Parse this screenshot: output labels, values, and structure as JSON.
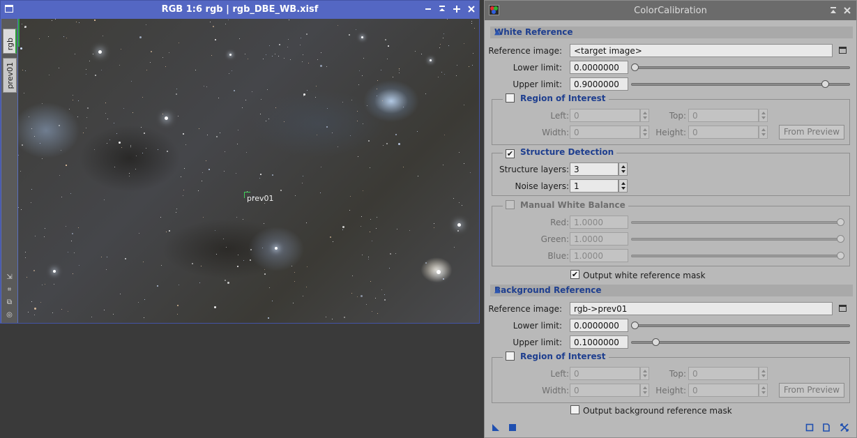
{
  "image_window": {
    "title": "RGB 1:6 rgb | rgb_DBE_WB.xisf",
    "tabs": [
      "rgb",
      "prev01"
    ],
    "preview_label": "prev01",
    "buttons": [
      "shade",
      "maximize",
      "close"
    ]
  },
  "panel": {
    "title": "ColorCalibration",
    "white_reference": {
      "header": "White Reference",
      "reference_image_label": "Reference image:",
      "reference_image_value": "<target image>",
      "lower_limit_label": "Lower limit:",
      "lower_limit_value": "0.0000000",
      "lower_limit_slider": 0.0,
      "upper_limit_label": "Upper limit:",
      "upper_limit_value": "0.9000000",
      "upper_limit_slider": 0.9,
      "roi": {
        "title": "Region of Interest",
        "checked": false,
        "left_label": "Left:",
        "left_value": "0",
        "top_label": "Top:",
        "top_value": "0",
        "width_label": "Width:",
        "width_value": "0",
        "height_label": "Height:",
        "height_value": "0",
        "from_preview": "From Preview"
      },
      "structure_detection": {
        "title": "Structure Detection",
        "checked": true,
        "structure_layers_label": "Structure layers:",
        "structure_layers_value": "3",
        "noise_layers_label": "Noise layers:",
        "noise_layers_value": "1"
      },
      "manual_white_balance": {
        "title": "Manual White Balance",
        "checked": false,
        "red_label": "Red:",
        "red_value": "1.0000",
        "green_label": "Green:",
        "green_value": "1.0000",
        "blue_label": "Blue:",
        "blue_value": "1.0000"
      },
      "output_mask_label": "Output white reference mask",
      "output_mask_checked": true
    },
    "background_reference": {
      "header": "Background Reference",
      "reference_image_label": "Reference image:",
      "reference_image_value": "rgb->prev01",
      "lower_limit_label": "Lower limit:",
      "lower_limit_value": "0.0000000",
      "lower_limit_slider": 0.0,
      "upper_limit_label": "Upper limit:",
      "upper_limit_value": "0.1000000",
      "upper_limit_slider": 0.1,
      "roi": {
        "title": "Region of Interest",
        "checked": false,
        "left_label": "Left:",
        "left_value": "0",
        "top_label": "Top:",
        "top_value": "0",
        "width_label": "Width:",
        "width_value": "0",
        "height_label": "Height:",
        "height_value": "0",
        "from_preview": "From Preview"
      },
      "output_mask_label": "Output background reference mask",
      "output_mask_checked": false
    },
    "colors": {
      "section_text": "#1f3f8f",
      "accent_blue": "#2d56b0",
      "window_title": "#5467c3"
    }
  }
}
